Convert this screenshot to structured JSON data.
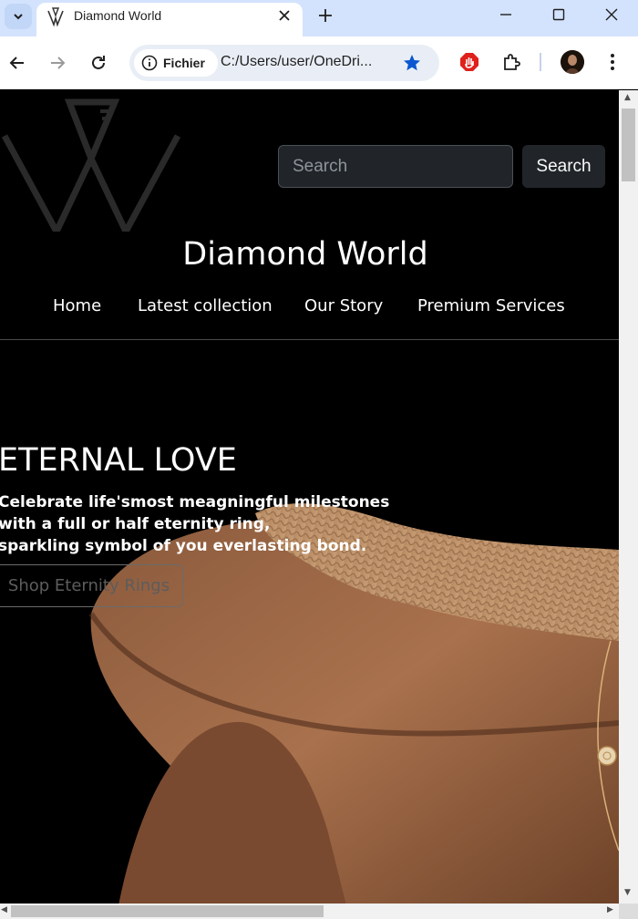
{
  "browser": {
    "tab_title": "Diamond World",
    "site_info_label": "Fichier",
    "url": "C:/Users/user/OneDri..."
  },
  "site": {
    "search": {
      "placeholder": "Search",
      "button_label": "Search"
    },
    "title": "Diamond World",
    "nav": [
      {
        "label": "Home"
      },
      {
        "label": "Latest collection"
      },
      {
        "label": "Our Story"
      },
      {
        "label": "Premium Services"
      }
    ]
  },
  "hero": {
    "title": "ETERNAL LOVE",
    "lines": [
      "Celebrate life'smost meagningful milestones",
      "with a full or half eternity ring,",
      "sparkling symbol of you everlasting bond."
    ],
    "button_label": "Shop Eternity Rings"
  },
  "colors": {
    "tabbar_bg": "#d3e3fd",
    "page_bg": "#000000",
    "accent_star": "#0b57d0",
    "input_bg": "#212529"
  }
}
